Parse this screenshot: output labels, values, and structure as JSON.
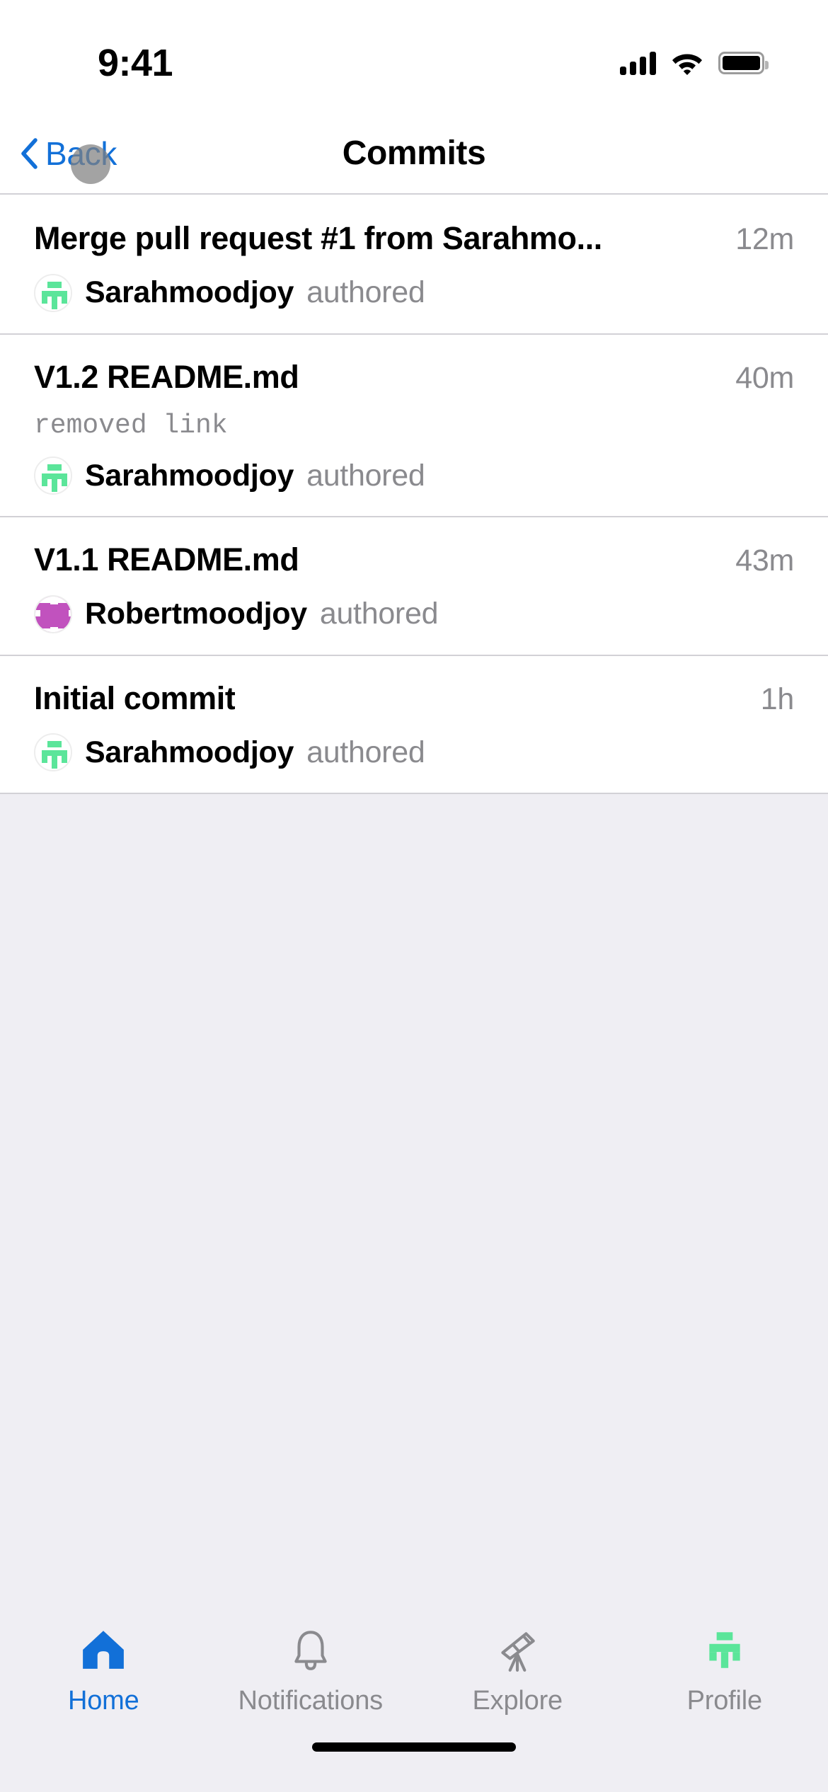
{
  "status_bar": {
    "time": "9:41",
    "signal_icon": "cellular-signal-icon",
    "wifi_icon": "wifi-icon",
    "battery_icon": "battery-full-icon"
  },
  "nav_bar": {
    "back_label": "Back",
    "back_icon": "chevron-left-icon",
    "title": "Commits",
    "accent_color": "#1270D8",
    "touch_indicator": "tap-indicator"
  },
  "commits": [
    {
      "title": "Merge pull request #1 from Sarahmo...",
      "time": "12m",
      "message": "",
      "author": "Sarahmoodjoy",
      "verb": "authored",
      "avatar_color": "#5BE59A",
      "avatar_icon": "identicon-avatar"
    },
    {
      "title": "V1.2 README.md",
      "time": "40m",
      "message": "removed link",
      "author": "Sarahmoodjoy",
      "verb": "authored",
      "avatar_color": "#5BE59A",
      "avatar_icon": "identicon-avatar"
    },
    {
      "title": "V1.1 README.md",
      "time": "43m",
      "message": "",
      "author": "Robertmoodjoy",
      "verb": "authored",
      "avatar_color": "#C152BE",
      "avatar_icon": "identicon-avatar"
    },
    {
      "title": "Initial commit",
      "time": "1h",
      "message": "",
      "author": "Sarahmoodjoy",
      "verb": "authored",
      "avatar_color": "#5BE59A",
      "avatar_icon": "identicon-avatar"
    }
  ],
  "tab_bar": {
    "active": "Home",
    "active_color": "#1270D8",
    "inactive_color": "#8A8A8E",
    "items": [
      {
        "label": "Home",
        "icon": "home-icon"
      },
      {
        "label": "Notifications",
        "icon": "bell-icon"
      },
      {
        "label": "Explore",
        "icon": "telescope-icon"
      },
      {
        "label": "Profile",
        "icon": "identicon-avatar-icon"
      }
    ]
  },
  "home_indicator": {
    "name": "home-indicator"
  },
  "colors": {
    "background": "#EFEEF3",
    "surface": "#FFFFFF",
    "separator": "#D2D1D6",
    "secondary_text": "#8A8A8E",
    "primary_text": "#000000"
  }
}
